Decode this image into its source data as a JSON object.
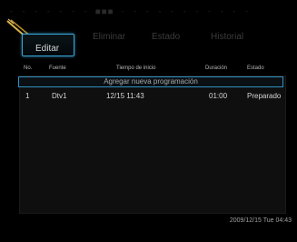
{
  "title_bar": {
    "text": "- - - - - - - ■■■ - - - - - - - - - - -"
  },
  "tabs": [
    {
      "label": "Editar"
    },
    {
      "label": "Eliminar"
    },
    {
      "label": "Estado"
    },
    {
      "label": "Historial"
    }
  ],
  "table": {
    "headers": [
      "No.",
      "Fuente",
      "Tiempo de inicio",
      "Duración",
      "Estado"
    ],
    "add_row_label": "Agregar nueva programación",
    "rows": [
      {
        "no": "1",
        "source": "Dtv1",
        "start": "12/15 11:43",
        "duration": "01:00",
        "status": "Preparado"
      }
    ]
  },
  "footer": {
    "datetime": "2009/12/15 Tue 04:43"
  },
  "colors": {
    "accent": "#3aa7d8",
    "background": "#000000"
  }
}
